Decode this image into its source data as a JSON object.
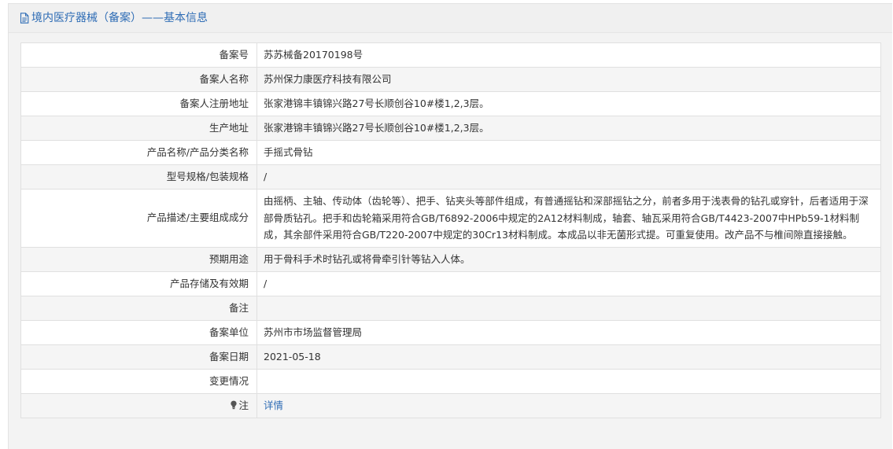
{
  "header": {
    "title": "境内医疗器械（备案）——基本信息"
  },
  "rows": [
    {
      "label": "备案号",
      "value": "苏苏械备20170198号"
    },
    {
      "label": "备案人名称",
      "value": "苏州保力康医疗科技有限公司"
    },
    {
      "label": "备案人注册地址",
      "value": "张家港锦丰镇锦兴路27号长顺创谷10#楼1,2,3层。"
    },
    {
      "label": "生产地址",
      "value": "张家港锦丰镇锦兴路27号长顺创谷10#楼1,2,3层。"
    },
    {
      "label": "产品名称/产品分类名称",
      "value": "手摇式骨钻"
    },
    {
      "label": "型号规格/包装规格",
      "value": "/"
    },
    {
      "label": "产品描述/主要组成成分",
      "value": "由摇柄、主轴、传动体（齿轮等）、把手、钻夹头等部件组成，有普通摇钻和深部摇钻之分，前者多用于浅表骨的钻孔或穿针，后者适用于深部骨质钻孔。把手和齿轮箱采用符合GB/T6892-2006中规定的2A12材料制成，轴套、轴瓦采用符合GB/T4423-2007中HPb59-1材料制成，其余部件采用符合GB/T220-2007中规定的30Cr13材料制成。本成品以非无菌形式提。可重复使用。改产品不与椎间隙直接接触。"
    },
    {
      "label": "预期用途",
      "value": "用于骨科手术时钻孔或将骨牵引针等钻入人体。"
    },
    {
      "label": "产品存储及有效期",
      "value": "/"
    },
    {
      "label": "备注",
      "value": ""
    },
    {
      "label": "备案单位",
      "value": "苏州市市场监督管理局"
    },
    {
      "label": "备案日期",
      "value": "2021-05-18"
    },
    {
      "label": "变更情况",
      "value": ""
    }
  ],
  "note": {
    "label": "注",
    "link": "详情",
    "icon": "lightbulb-icon"
  },
  "colors": {
    "accent": "#2e6cb5",
    "header_bg": "#f0f0f0",
    "row_alt": "#f5f5f5",
    "border": "#e0e0e0"
  }
}
